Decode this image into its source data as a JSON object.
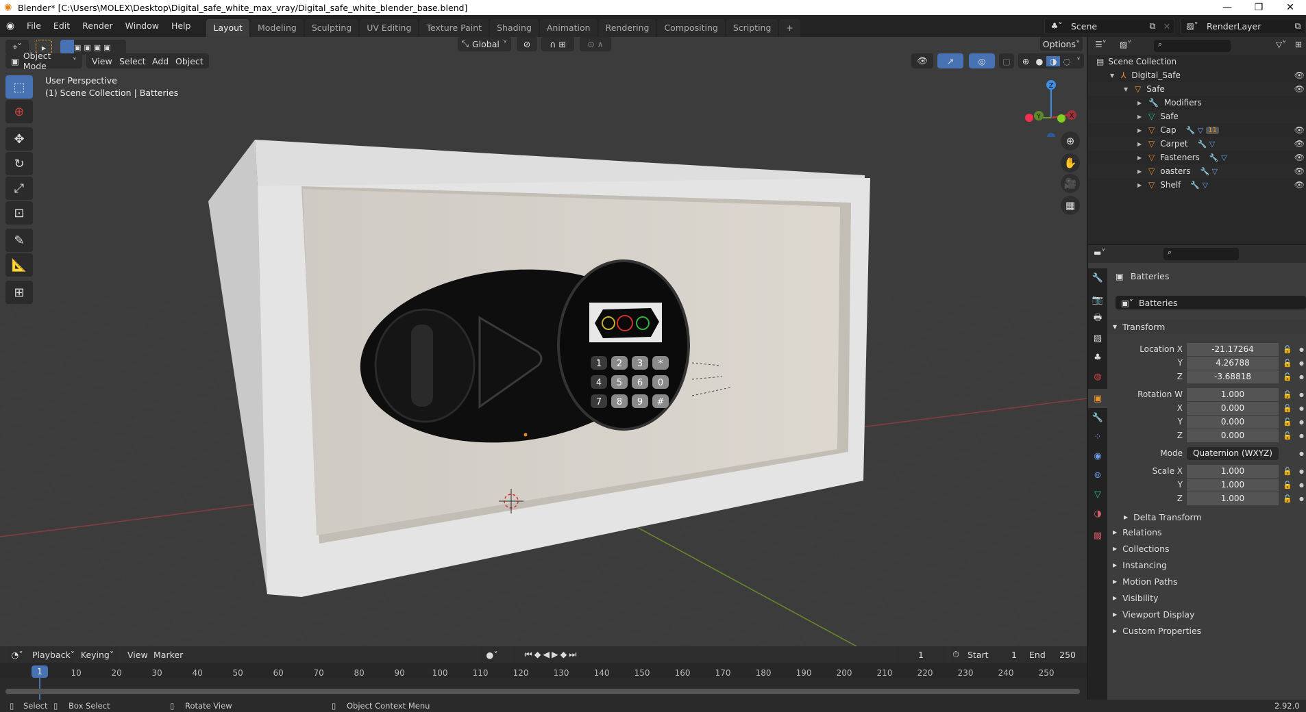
{
  "window": {
    "title": "Blender* [C:\\Users\\MOLEX\\Desktop\\Digital_safe_white_max_vray/Digital_safe_white_blender_base.blend]",
    "controls": [
      "minimize-icon",
      "maximize-icon",
      "close-icon"
    ]
  },
  "menu": [
    "File",
    "Edit",
    "Render",
    "Window",
    "Help"
  ],
  "workspaces": {
    "tabs": [
      "Layout",
      "Modeling",
      "Sculpting",
      "UV Editing",
      "Texture Paint",
      "Shading",
      "Animation",
      "Rendering",
      "Compositing",
      "Scripting"
    ],
    "active": "Layout",
    "add_label": "+"
  },
  "scene_selector": {
    "value": "Scene"
  },
  "view_layer_selector": {
    "value": "RenderLayer"
  },
  "viewport": {
    "mode": "Object Mode",
    "header_menus": [
      "View",
      "Select",
      "Add",
      "Object"
    ],
    "orientation": "Global",
    "options_label": "Options",
    "overlay_line1": "User Perspective",
    "overlay_line2": "(1) Scene Collection | Batteries",
    "gizmo_axes": {
      "z": "Z",
      "y": "Y",
      "x": "X"
    },
    "tools": [
      "select-box",
      "cursor",
      "move",
      "rotate",
      "scale",
      "transform",
      "annotate",
      "measure",
      "add-cube"
    ],
    "keypad": [
      "1",
      "2",
      "3",
      "*",
      "4",
      "5",
      "6",
      "0",
      "7",
      "8",
      "9",
      "#"
    ]
  },
  "outliner": {
    "root": "Scene Collection",
    "items": [
      {
        "name": "Digital_Safe",
        "type": "empty",
        "depth": 1,
        "expanded": true
      },
      {
        "name": "Safe",
        "type": "mesh-object",
        "depth": 2,
        "expanded": true
      },
      {
        "name": "Modifiers",
        "type": "modifier",
        "depth": 3
      },
      {
        "name": "Safe",
        "type": "mesh-data",
        "depth": 3
      },
      {
        "name": "Cap",
        "type": "mesh-object",
        "depth": 3,
        "children_badge": "11"
      },
      {
        "name": "Carpet",
        "type": "mesh-object",
        "depth": 3
      },
      {
        "name": "Fasteners",
        "type": "mesh-object",
        "depth": 3
      },
      {
        "name": "oasters",
        "type": "mesh-object",
        "depth": 3
      },
      {
        "name": "Shelf",
        "type": "mesh-object",
        "depth": 3
      }
    ]
  },
  "properties": {
    "object_name": "Batteries",
    "data_name": "Batteries",
    "transform_label": "Transform",
    "location": {
      "label": "Location X",
      "x": "-21.17264",
      "y": "4.26788",
      "z": "-3.68818"
    },
    "rotation": {
      "label": "Rotation W",
      "w": "1.000",
      "x": "0.000",
      "y": "0.000",
      "z": "0.000"
    },
    "mode": {
      "label": "Mode",
      "value": "Quaternion (WXYZ)"
    },
    "scale": {
      "label": "Scale X",
      "x": "1.000",
      "y": "1.000",
      "z": "1.000"
    },
    "axis_labels": {
      "y": "Y",
      "z": "Z",
      "x": "X"
    },
    "delta_transform": "Delta Transform",
    "panels": [
      "Relations",
      "Collections",
      "Instancing",
      "Motion Paths",
      "Visibility",
      "Viewport Display",
      "Custom Properties"
    ]
  },
  "timeline": {
    "menus": [
      "Playback",
      "Keying",
      "View",
      "Marker"
    ],
    "current_frame": "1",
    "start_label": "Start",
    "start": "1",
    "end_label": "End",
    "end": "250",
    "ticks": [
      "10",
      "20",
      "30",
      "40",
      "50",
      "60",
      "70",
      "80",
      "90",
      "100",
      "110",
      "120",
      "130",
      "140",
      "150",
      "160",
      "170",
      "180",
      "190",
      "200",
      "210",
      "220",
      "230",
      "240",
      "250"
    ],
    "playhead": "1"
  },
  "statusbar": {
    "select": "Select",
    "box_select": "Box Select",
    "rotate_view": "Rotate View",
    "context_menu": "Object Context Menu",
    "version": "2.92.0"
  }
}
